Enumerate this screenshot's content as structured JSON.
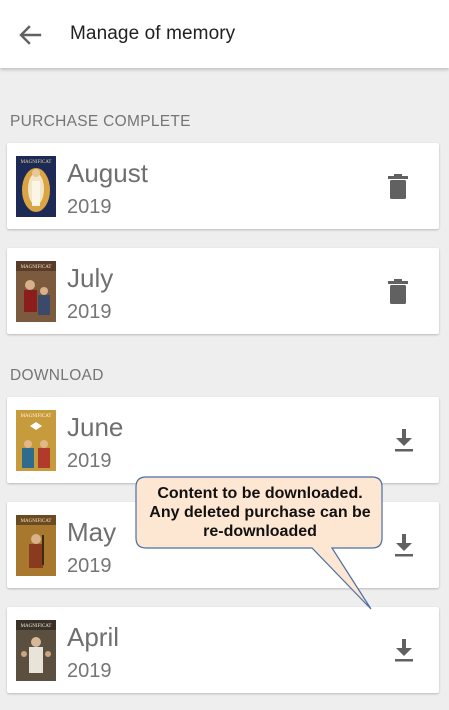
{
  "header": {
    "title": "Manage of memory",
    "back_icon": "arrow-left-icon"
  },
  "sections": {
    "purchase": {
      "label": "PURCHASE COMPLETE"
    },
    "download": {
      "label": "DOWNLOAD"
    }
  },
  "items": [
    {
      "month": "August",
      "year": "2019",
      "action_icon": "trash-icon",
      "cover_title": "MAGNIFICAT"
    },
    {
      "month": "July",
      "year": "2019",
      "action_icon": "trash-icon",
      "cover_title": "MAGNIFICAT"
    },
    {
      "month": "June",
      "year": "2019",
      "action_icon": "download-icon",
      "cover_title": "MAGNIFICAT"
    },
    {
      "month": "May",
      "year": "2019",
      "action_icon": "download-icon",
      "cover_title": "MAGNIFICAT"
    },
    {
      "month": "April",
      "year": "2019",
      "action_icon": "download-icon",
      "cover_title": "MAGNIFICAT"
    }
  ],
  "callout": {
    "line1": "Content to be downloaded.",
    "line2": "Any deleted purchase can be",
    "line3": "re-downloaded",
    "fill_color": "#fde6d2",
    "border_color": "#4a6fa5"
  },
  "colors": {
    "icon": "#616161",
    "text_secondary": "#757575"
  }
}
